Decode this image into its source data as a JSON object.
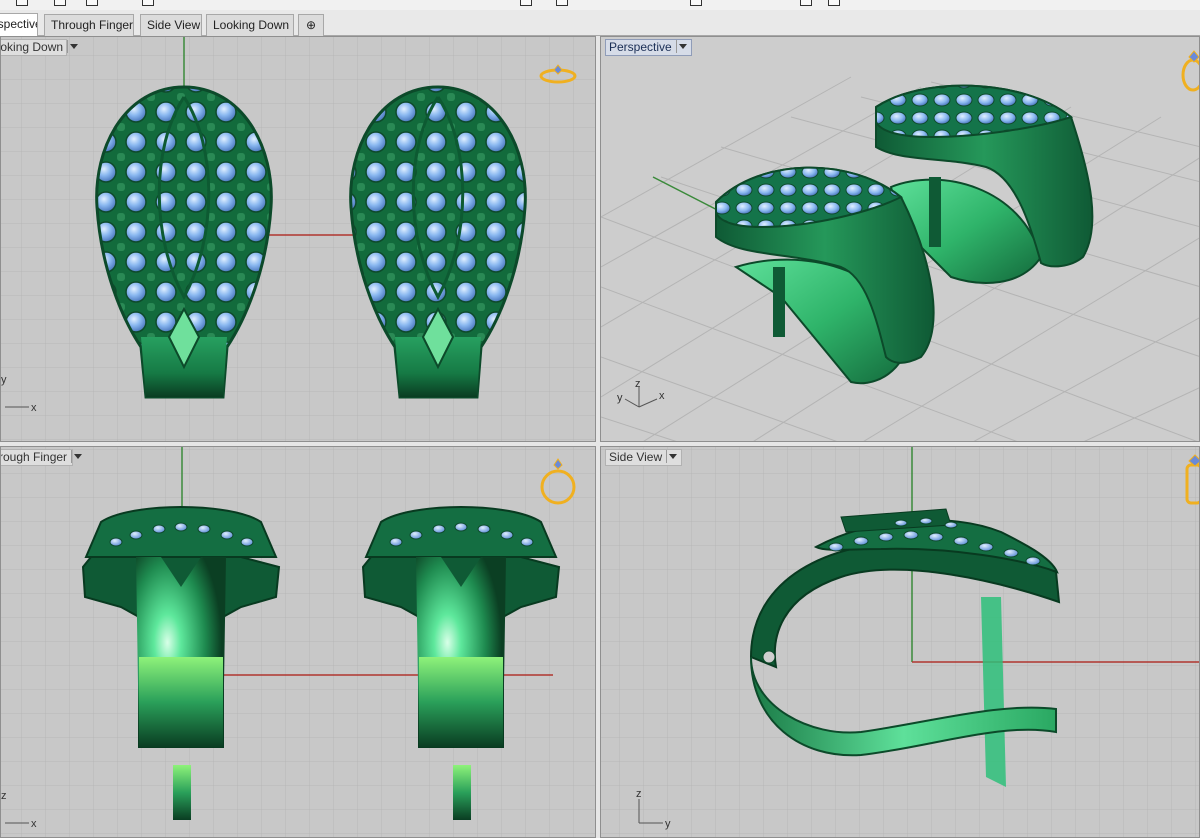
{
  "tabs": [
    {
      "label": "Perspective",
      "active": true
    },
    {
      "label": "Through Finger",
      "active": false
    },
    {
      "label": "Side View",
      "active": false
    },
    {
      "label": "Looking Down",
      "active": false
    }
  ],
  "add_tab_label": "⊕",
  "viewports": {
    "top_left": {
      "label": "Looking Down",
      "axes": [
        "y",
        "x"
      ]
    },
    "top_right": {
      "label": "Perspective",
      "axes": [
        "z",
        "y",
        "x"
      ]
    },
    "bottom_left": {
      "label": "Through Finger",
      "axes": [
        "z",
        "x"
      ]
    },
    "bottom_right": {
      "label": "Side View",
      "axes": [
        "z",
        "y"
      ]
    }
  },
  "colors": {
    "viewport_bg": "#c8c8c8",
    "grid_line": "#b6b6b6",
    "grid_major": "#a8a8a8",
    "x_axis": "#b0352f",
    "y_axis": "#3a8a3a",
    "metal_dark": "#0f5a35",
    "metal_mid": "#1f8a52",
    "metal_light": "#4fd38a",
    "gem": "#8ab8f0",
    "widget": "#f0b020"
  },
  "icons": {
    "navigation_widget": "ring-widget-icon",
    "view_menu": "chevron-down-icon",
    "add_tab": "plus-circle-icon"
  }
}
